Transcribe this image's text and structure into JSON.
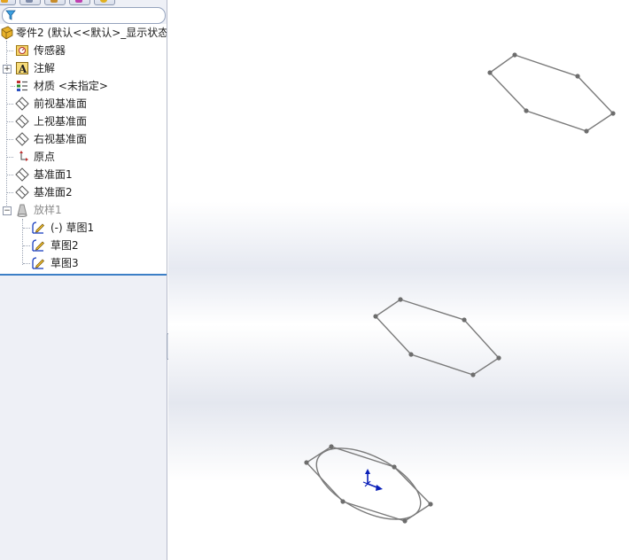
{
  "tree": {
    "root_label": "零件2  (默认<<默认>_显示状态",
    "items": [
      {
        "label": "传感器",
        "icon": "sensor-icon"
      },
      {
        "label": "注解",
        "icon": "annotation-icon"
      },
      {
        "label": "材质 <未指定>",
        "icon": "material-icon"
      },
      {
        "label": "前视基准面",
        "icon": "plane-icon"
      },
      {
        "label": "上视基准面",
        "icon": "plane-icon"
      },
      {
        "label": "右视基准面",
        "icon": "plane-icon"
      },
      {
        "label": "原点",
        "icon": "origin-icon"
      },
      {
        "label": "基准面1",
        "icon": "plane-icon"
      },
      {
        "label": "基准面2",
        "icon": "plane-icon"
      },
      {
        "label": "放样1",
        "icon": "loft-icon"
      }
    ],
    "loft_children": [
      {
        "label": "(-) 草图1",
        "icon": "sketch-icon"
      },
      {
        "label": "草图2",
        "icon": "sketch-icon"
      },
      {
        "label": "草图3",
        "icon": "sketch-icon"
      }
    ]
  },
  "colors": {
    "sketch_line": "#7a7a7a",
    "origin_blue": "#0a1fb8",
    "selection_bar": "#3c7fc6"
  }
}
